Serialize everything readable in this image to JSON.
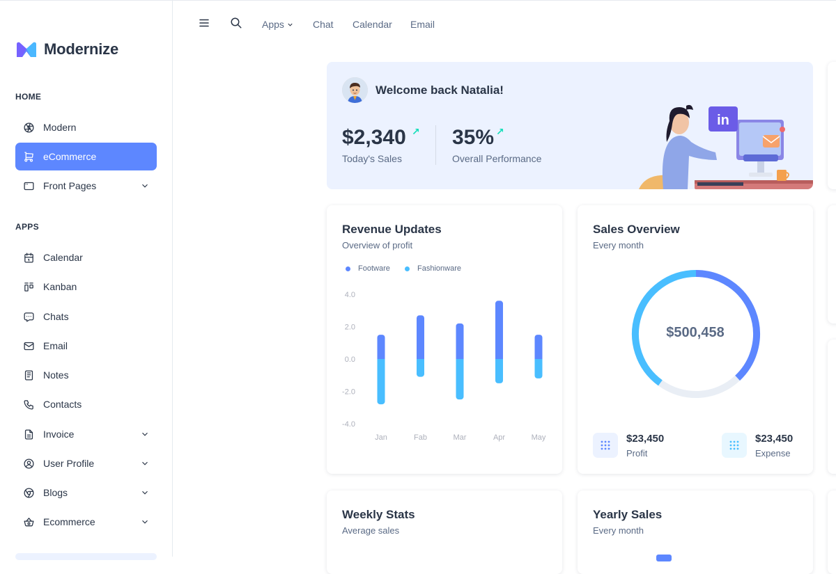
{
  "brand": {
    "name": "Modernize"
  },
  "sidebar": {
    "sections": [
      {
        "title": "HOME"
      },
      {
        "title": "APPS"
      }
    ],
    "items": [
      {
        "label": "Modern",
        "icon": "aperture-icon"
      },
      {
        "label": "eCommerce",
        "icon": "shopping-cart-icon",
        "active": true
      },
      {
        "label": "Front Pages",
        "icon": "app-window-icon",
        "has_children": true
      },
      {
        "label": "Calendar",
        "icon": "calendar-icon"
      },
      {
        "label": "Kanban",
        "icon": "kanban-icon"
      },
      {
        "label": "Chats",
        "icon": "chat-icon"
      },
      {
        "label": "Email",
        "icon": "mail-icon"
      },
      {
        "label": "Notes",
        "icon": "notes-icon"
      },
      {
        "label": "Contacts",
        "icon": "phone-icon"
      },
      {
        "label": "Invoice",
        "icon": "file-text-icon",
        "has_children": true
      },
      {
        "label": "User Profile",
        "icon": "user-circle-icon",
        "has_children": true
      },
      {
        "label": "Blogs",
        "icon": "chrome-icon",
        "has_children": true
      },
      {
        "label": "Ecommerce",
        "icon": "basket-icon",
        "has_children": true
      }
    ]
  },
  "topbar": {
    "apps_label": "Apps",
    "links": [
      "Chat",
      "Calendar",
      "Email"
    ]
  },
  "welcome": {
    "title": "Welcome back Natalia!",
    "sales_value": "$2,340",
    "sales_label": "Today's Sales",
    "performance_value": "35%",
    "performance_label": "Overall Performance",
    "arrow": "↗"
  },
  "revenue": {
    "title": "Revenue Updates",
    "subtitle": "Overview of profit"
  },
  "sales_overview": {
    "title": "Sales Overview",
    "subtitle": "Every month",
    "total": "$500,458",
    "profit_value": "$23,450",
    "profit_label": "Profit",
    "expense_value": "$23,450",
    "expense_label": "Expense"
  },
  "weekly": {
    "title": "Weekly Stats",
    "subtitle": "Average sales"
  },
  "yearly": {
    "title": "Yearly Sales",
    "subtitle": "Every month"
  },
  "colors": {
    "primary": "#5d87ff",
    "secondary": "#49beff",
    "track": "#e9eef5"
  },
  "chart_data": [
    {
      "type": "bar",
      "categories": [
        "Jan",
        "Fab",
        "Mar",
        "Apr",
        "May"
      ],
      "series": [
        {
          "name": "Footware",
          "values": [
            1.5,
            2.7,
            2.2,
            3.6,
            1.5
          ]
        },
        {
          "name": "Fashionware",
          "values": [
            -2.8,
            -1.1,
            -2.5,
            -1.5,
            -1.2
          ]
        }
      ],
      "yticks": [
        "4.0",
        "2.0",
        "0.0",
        "-2.0",
        "-4.0"
      ],
      "ylim": [
        -4,
        4
      ],
      "stacked": true,
      "legend": "top-left"
    },
    {
      "type": "pie",
      "style": "donut",
      "slices": [
        {
          "value": 38,
          "color": "#5d87ff"
        },
        {
          "value": 40,
          "color": "#49beff"
        },
        {
          "value": 22,
          "color": "#e9eef5"
        }
      ]
    }
  ]
}
